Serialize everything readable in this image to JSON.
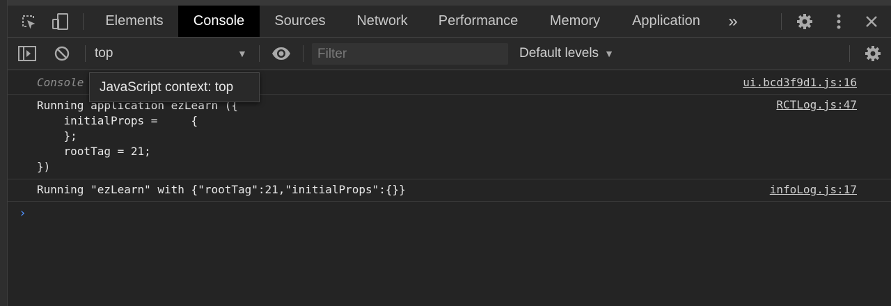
{
  "tabs": [
    {
      "label": "Elements",
      "active": false
    },
    {
      "label": "Console",
      "active": true
    },
    {
      "label": "Sources",
      "active": false
    },
    {
      "label": "Network",
      "active": false
    },
    {
      "label": "Performance",
      "active": false
    },
    {
      "label": "Memory",
      "active": false
    },
    {
      "label": "Application",
      "active": false
    }
  ],
  "tabbar": {
    "more_tabs_glyph": "»",
    "icons": [
      "inspect-element-icon",
      "device-toolbar-icon",
      "more-tabs-icon",
      "settings-gear-icon",
      "vertical-dots-icon",
      "close-icon"
    ]
  },
  "toolbar": {
    "context": "top",
    "filter_placeholder": "Filter",
    "filter_value": "",
    "levels": "Default levels",
    "icons": [
      "sidebar-toggle-icon",
      "clear-console-icon",
      "live-expression-eye-icon",
      "console-settings-gear-icon"
    ]
  },
  "tooltip": {
    "text": "JavaScript context: top"
  },
  "messages": [
    {
      "text": "Console",
      "source": "ui.bcd3f9d1.js:16"
    },
    {
      "text": "Running application ezLearn ({\n    initialProps =     {\n    };\n    rootTag = 21;\n})",
      "source": "RCTLog.js:47"
    },
    {
      "text": "Running \"ezLearn\" with {\"rootTag\":21,\"initialProps\":{}}",
      "source": "infoLog.js:17"
    }
  ],
  "prompt_glyph": "›",
  "colors": {
    "background": "#242424",
    "toolbar": "#292929",
    "active_tab": "#000000",
    "prompt": "#4e8ff7",
    "text": "#e8e8e8"
  }
}
